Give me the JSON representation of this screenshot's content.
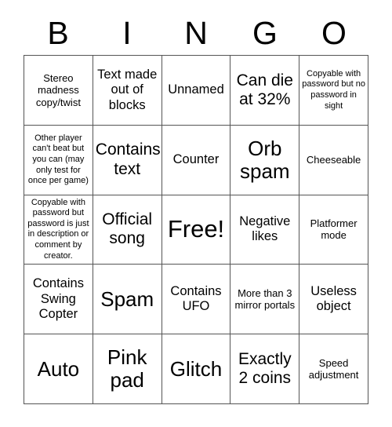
{
  "card": {
    "title": "BINGO",
    "header_letters": [
      "B",
      "I",
      "N",
      "G",
      "O"
    ],
    "grid_size": "5x5",
    "colors": {
      "background": "#ffffff",
      "border": "#555555",
      "text": "#000000"
    },
    "cells": [
      {
        "id": "b1",
        "column": "B",
        "row": 1,
        "text": "Stereo madness copy/twist",
        "size": "sm",
        "free_space": false
      },
      {
        "id": "i1",
        "column": "I",
        "row": 1,
        "text": "Text made out of blocks",
        "size": "md",
        "free_space": false
      },
      {
        "id": "n1",
        "column": "N",
        "row": 1,
        "text": "Unnamed",
        "secondary": "—",
        "size": "md",
        "free_space": false
      },
      {
        "id": "g1",
        "column": "G",
        "row": 1,
        "text": "Can die at 32%",
        "size": "lg",
        "free_space": false
      },
      {
        "id": "o1",
        "column": "O",
        "row": 1,
        "text": "Copyable with password but no password in sight",
        "size": "xs",
        "free_space": false
      },
      {
        "id": "b2",
        "column": "B",
        "row": 2,
        "text": "Other player can't beat but you can (may only test for once per game)",
        "size": "xs",
        "free_space": false
      },
      {
        "id": "i2",
        "column": "I",
        "row": 2,
        "text": "Contains text",
        "size": "lg",
        "free_space": false
      },
      {
        "id": "n2",
        "column": "N",
        "row": 2,
        "text": "Counter",
        "size": "md",
        "free_space": false
      },
      {
        "id": "g2",
        "column": "G",
        "row": 2,
        "text": "Orb spam",
        "size": "xl",
        "free_space": false
      },
      {
        "id": "o2",
        "column": "O",
        "row": 2,
        "text": "Cheeseable",
        "size": "sm",
        "free_space": false
      },
      {
        "id": "b3",
        "column": "B",
        "row": 3,
        "text": "Copyable with password but password is just in description or comment by creator.",
        "size": "xs",
        "free_space": false
      },
      {
        "id": "i3",
        "column": "I",
        "row": 3,
        "text": "Official song",
        "size": "lg",
        "free_space": false
      },
      {
        "id": "n3",
        "column": "N",
        "row": 3,
        "text": "Free!",
        "size": "xxl",
        "free_space": true
      },
      {
        "id": "g3",
        "column": "G",
        "row": 3,
        "text": "Negative likes",
        "size": "md",
        "free_space": false
      },
      {
        "id": "o3",
        "column": "O",
        "row": 3,
        "text": "Platformer mode",
        "size": "sm",
        "free_space": false
      },
      {
        "id": "b4",
        "column": "B",
        "row": 4,
        "text": "Contains Swing Copter",
        "size": "md",
        "free_space": false
      },
      {
        "id": "i4",
        "column": "I",
        "row": 4,
        "text": "Spam",
        "size": "xl",
        "free_space": false
      },
      {
        "id": "n4",
        "column": "N",
        "row": 4,
        "text": "Contains UFO",
        "size": "md",
        "free_space": false
      },
      {
        "id": "g4",
        "column": "G",
        "row": 4,
        "text": "More than 3 mirror portals",
        "size": "sm",
        "free_space": false
      },
      {
        "id": "o4",
        "column": "O",
        "row": 4,
        "text": "Useless object",
        "size": "md",
        "free_space": false
      },
      {
        "id": "b5",
        "column": "B",
        "row": 5,
        "text": "Auto",
        "size": "xl",
        "free_space": false
      },
      {
        "id": "i5",
        "column": "I",
        "row": 5,
        "text": "Pink pad",
        "size": "xl",
        "free_space": false
      },
      {
        "id": "n5",
        "column": "N",
        "row": 5,
        "text": "Glitch",
        "size": "xl",
        "free_space": false
      },
      {
        "id": "g5",
        "column": "G",
        "row": 5,
        "text": "Exactly 2 coins",
        "size": "lg",
        "free_space": false
      },
      {
        "id": "o5",
        "column": "O",
        "row": 5,
        "text": "Speed adjustment",
        "size": "sm",
        "free_space": false
      }
    ]
  }
}
